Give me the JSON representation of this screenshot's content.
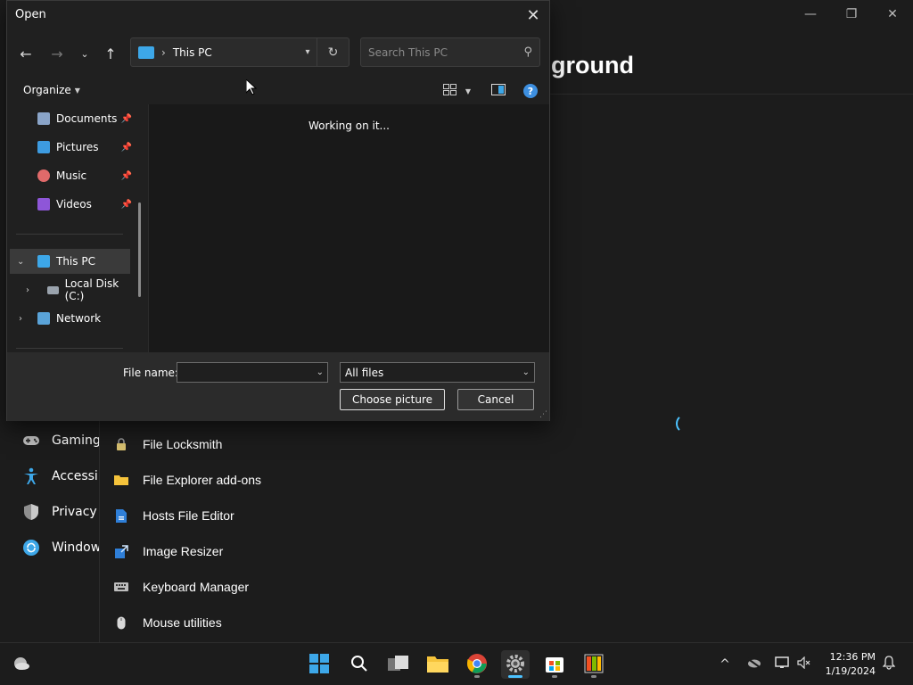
{
  "background_window": {
    "heading": "ground",
    "controls": {
      "minimize": "—",
      "maximize": "❐",
      "close": "✕"
    },
    "nav_items": [
      {
        "label": "Gaming",
        "icon": "gamepad-icon"
      },
      {
        "label": "Accessib",
        "icon": "accessibility-icon"
      },
      {
        "label": "Privacy &",
        "icon": "shield-icon"
      },
      {
        "label": "Window",
        "icon": "windows-update-icon"
      }
    ],
    "list_items": [
      {
        "label": "File Locksmith",
        "icon": "lock-icon"
      },
      {
        "label": "File Explorer add-ons",
        "icon": "folder-icon"
      },
      {
        "label": "Hosts File Editor",
        "icon": "document-icon"
      },
      {
        "label": "Image Resizer",
        "icon": "image-resize-icon"
      },
      {
        "label": "Keyboard Manager",
        "icon": "keyboard-icon"
      },
      {
        "label": "Mouse utilities",
        "icon": "mouse-icon"
      }
    ]
  },
  "dialog": {
    "title": "Open",
    "address": {
      "location": "This PC",
      "separator": "›"
    },
    "search": {
      "placeholder": "Search This PC"
    },
    "organize_label": "Organize",
    "help_label": "?",
    "tree": {
      "quick_access": [
        {
          "label": "Documents",
          "icon_color": "#8aa4c8"
        },
        {
          "label": "Pictures",
          "icon_color": "#3d9be0"
        },
        {
          "label": "Music",
          "icon_color": "#e06a6a"
        },
        {
          "label": "Videos",
          "icon_color": "#8e56d8"
        }
      ],
      "this_pc": "This PC",
      "local_disk": "Local Disk (C:)",
      "network": "Network"
    },
    "status_text": "Working on it...",
    "footer": {
      "file_name_label": "File name:",
      "file_name_value": "",
      "file_type": "All files",
      "choose_button": "Choose picture",
      "cancel_button": "Cancel"
    }
  },
  "taskbar": {
    "time": "12:36 PM",
    "date": "1/19/2024",
    "accent": "#4cc2ff"
  }
}
